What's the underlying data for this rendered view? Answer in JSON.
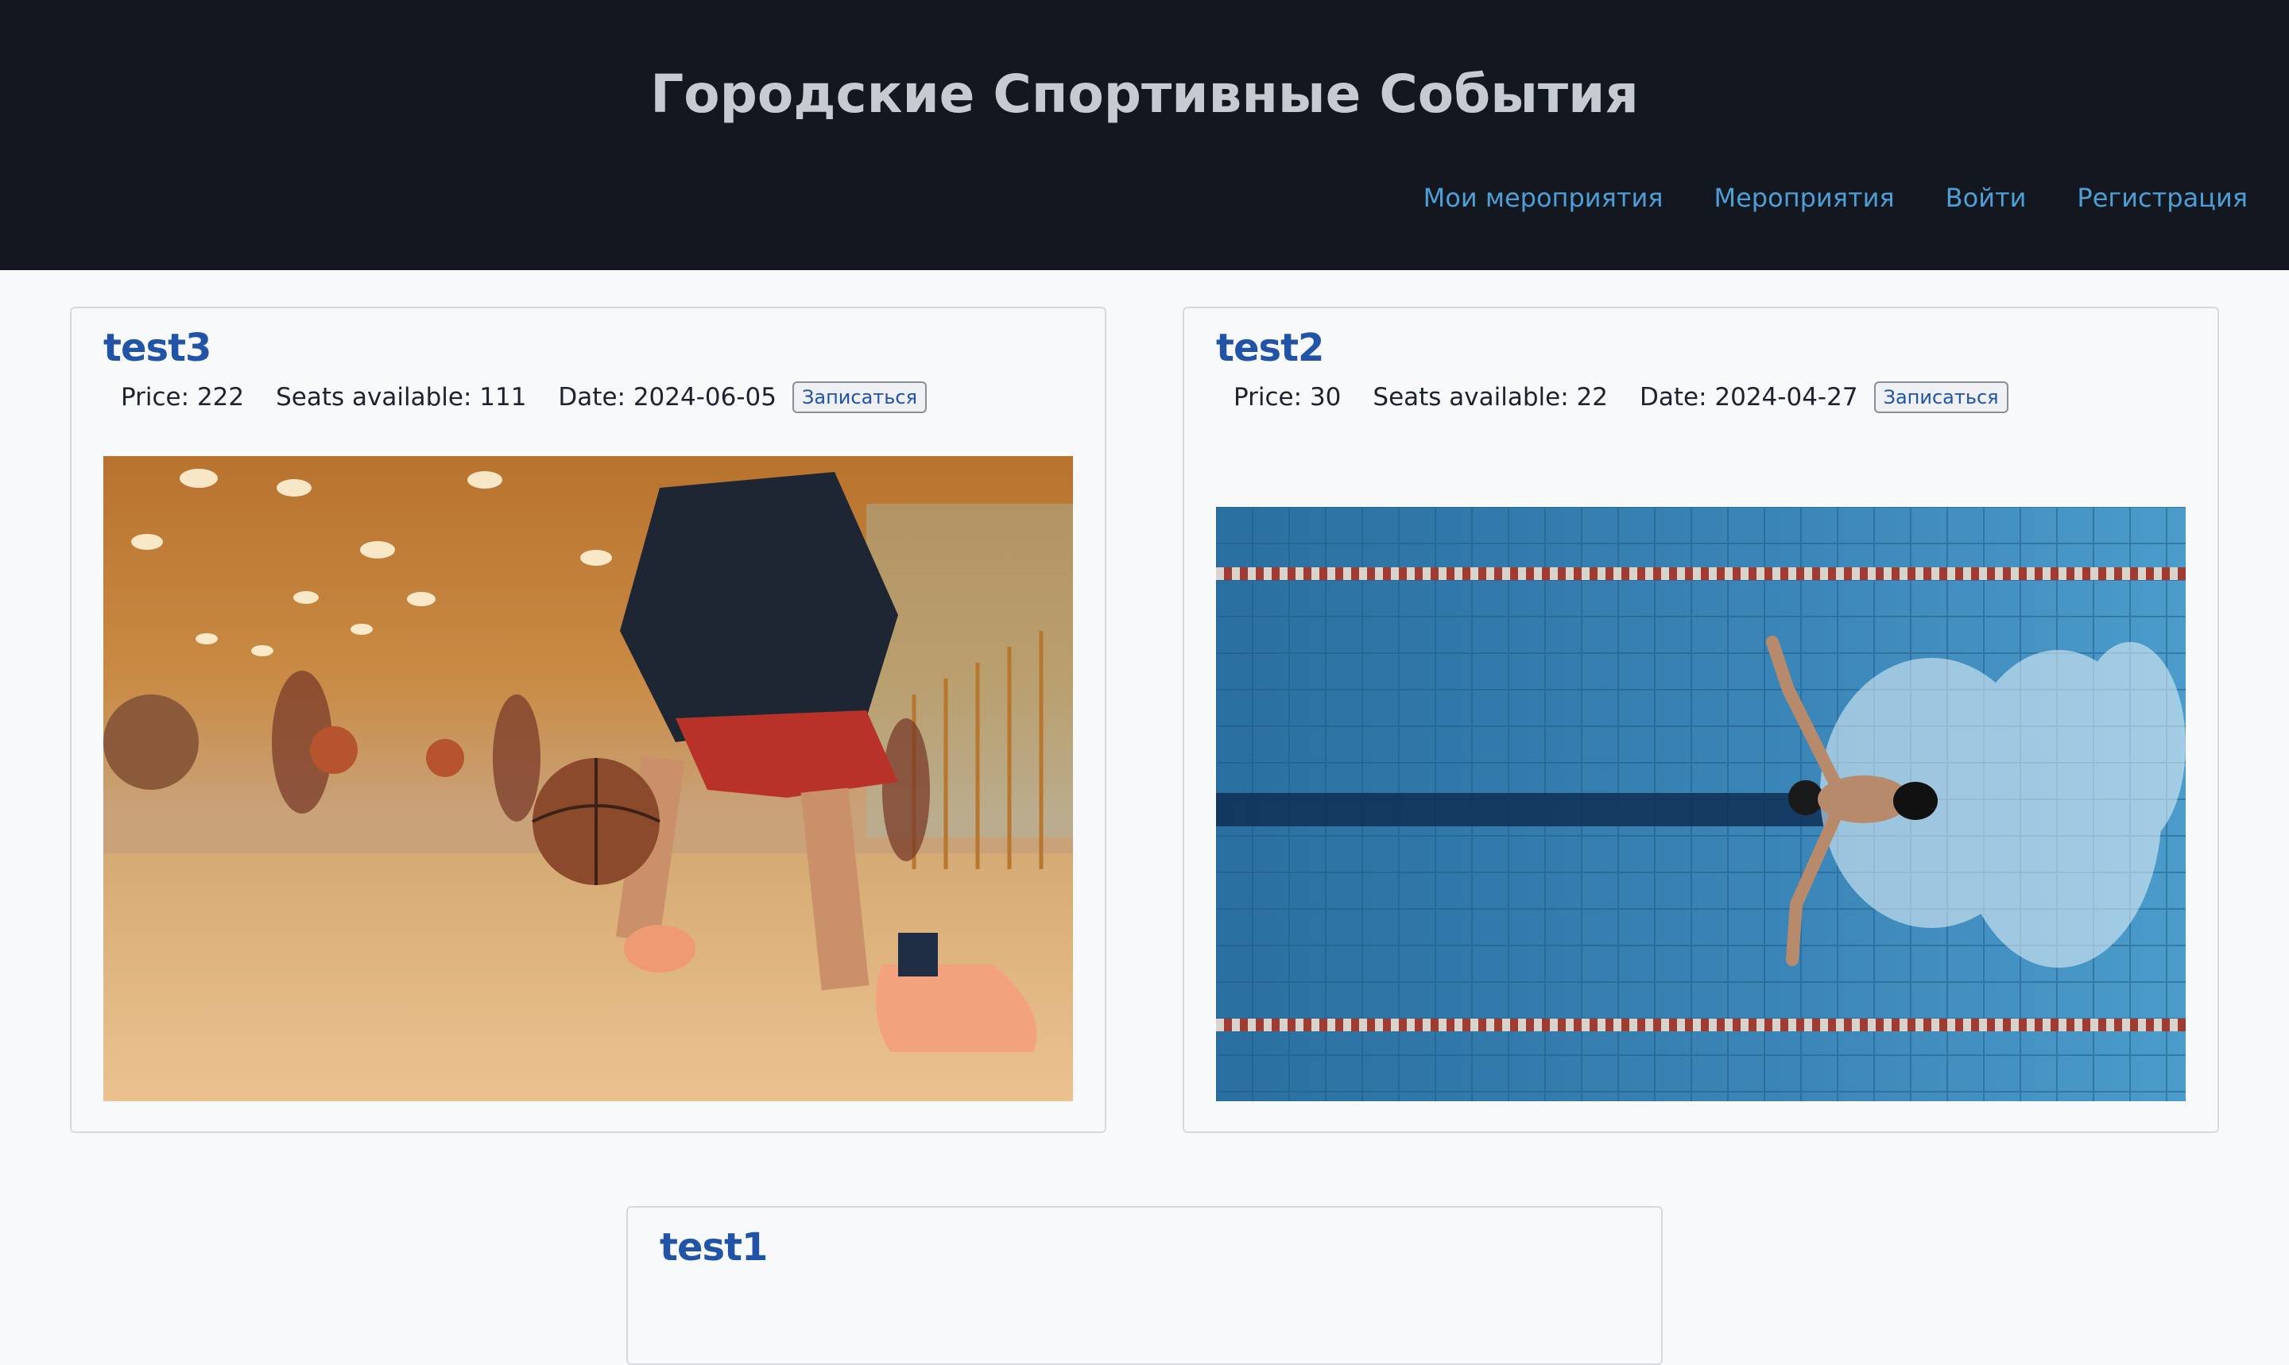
{
  "site": {
    "title": "Городские Спортивные События"
  },
  "nav": {
    "items": [
      "Мои мероприятия",
      "Мероприятия",
      "Войти",
      "Регистрация"
    ]
  },
  "labels": {
    "price": "Price:",
    "seats": "Seats available:",
    "date": "Date:",
    "join": "Записаться"
  },
  "events": [
    {
      "title": "test3",
      "price": "222",
      "seats": "111",
      "date": "2024-06-05",
      "image": "basketball-photo"
    },
    {
      "title": "test2",
      "price": "30",
      "seats": "22",
      "date": "2024-04-27",
      "image": "swimming-photo"
    },
    {
      "title": "test1"
    }
  ],
  "colors": {
    "header_bg": "#131820",
    "title_text": "#c6cbd2",
    "nav_link": "#4f9fd6",
    "card_title": "#2153a6",
    "page_bg": "#f8f9fa"
  }
}
